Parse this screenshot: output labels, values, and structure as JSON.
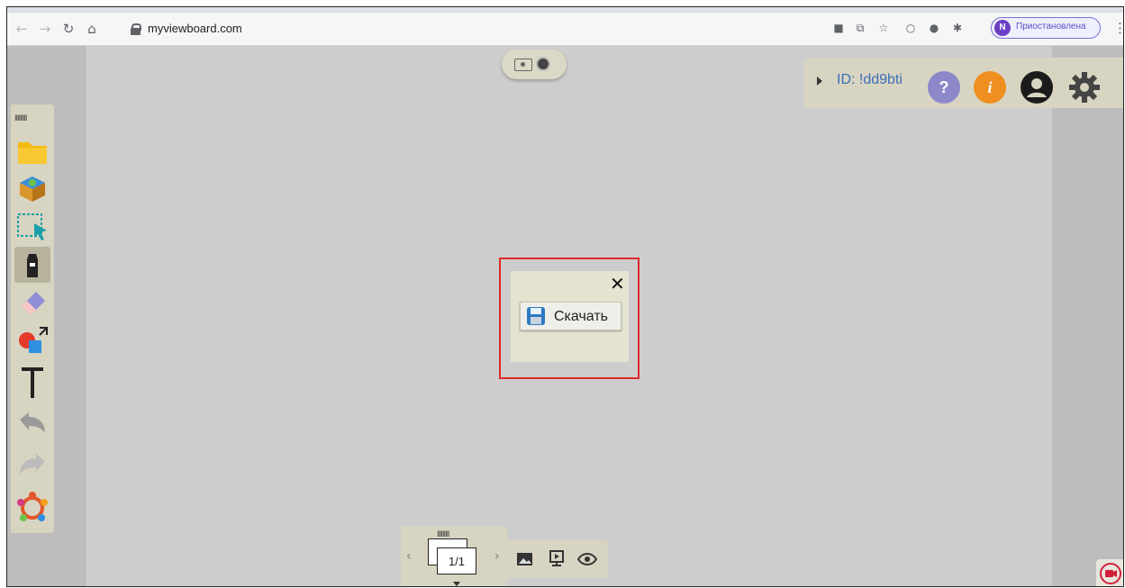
{
  "browser": {
    "url": "myviewboard.com",
    "profile_initial": "N",
    "profile_label": "Приостановлена",
    "nav_icons": {
      "back": "back-arrow-icon",
      "forward": "forward-arrow-icon",
      "reload": "reload-icon",
      "home": "home-icon"
    }
  },
  "top_right": {
    "id_label": "ID: !dd9bti",
    "help_glyph": "?",
    "info_glyph": "i",
    "colors": {
      "help": "#8d88c9",
      "info": "#ef8f1f",
      "id_text": "#3b6fb6"
    }
  },
  "dialog": {
    "close_glyph": "✕",
    "download_label": "Скачать",
    "highlight_color": "#e02a2a"
  },
  "pages": {
    "current": "1/1"
  },
  "toolbar_tools": [
    "folder-icon",
    "box-icon",
    "select-icon",
    "pen-icon",
    "eraser-icon",
    "shapes-icon",
    "text-icon",
    "undo-icon",
    "redo-icon",
    "collaboration-icon"
  ]
}
